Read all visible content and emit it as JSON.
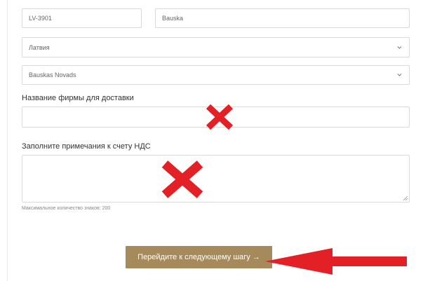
{
  "form": {
    "postal_code": "LV-3901",
    "city": "Bauska",
    "country": "Латвия",
    "region": "Bauskas Novads",
    "company_label": "Название фирмы для доставки",
    "company_value": "",
    "vat_label": "Заполните примечания к счету НДС",
    "vat_value": "",
    "vat_hint": "Максимальное количество знаков: 200",
    "next_button": "Перейдите к следующему шагу →"
  },
  "annotations": {
    "mark_color": "#e32026",
    "marks": [
      "x-mark",
      "x-mark",
      "arrow-left"
    ]
  },
  "colors": {
    "button_bg": "#a68a5b",
    "border": "#d9d9d9"
  }
}
